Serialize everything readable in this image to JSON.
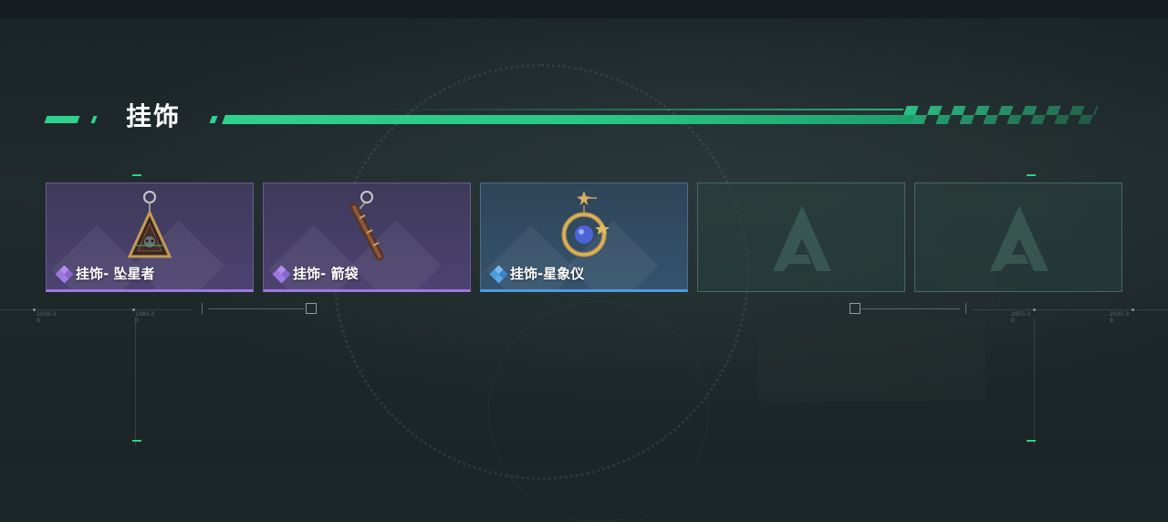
{
  "section": {
    "title": "挂饰"
  },
  "slots": [
    {
      "label": "挂饰- 坠星者",
      "rarity": "epic",
      "rarity_color": "#9d78e0",
      "icon": "triangle-pendant-icon"
    },
    {
      "label": "挂饰- 箭袋",
      "rarity": "epic",
      "rarity_color": "#9d78e0",
      "icon": "quiver-pendant-icon"
    },
    {
      "label": "挂饰-星象仪",
      "rarity": "rare",
      "rarity_color": "#4a9de0",
      "icon": "astrolabe-pendant-icon"
    },
    {
      "label": "",
      "rarity": "empty",
      "icon": "game-logo-icon"
    },
    {
      "label": "",
      "rarity": "empty",
      "icon": "game-logo-icon"
    }
  ],
  "hud": {
    "left_code_1": "2035-3\n9",
    "left_code_2": "1985-3\n0",
    "right_code_1": "1955-3\n0",
    "right_code_2": "2035-3\n9"
  },
  "colors": {
    "accent": "#2ed18e",
    "epic": "#9d78e0",
    "rare": "#4a9de0"
  }
}
